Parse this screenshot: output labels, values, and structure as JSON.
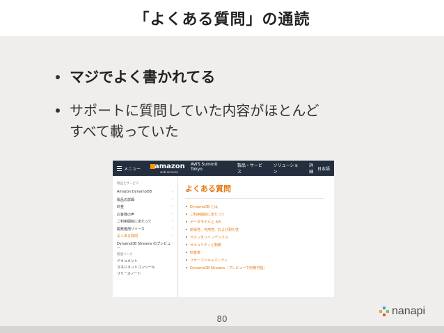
{
  "slide": {
    "title": "「よくある質問」の通読",
    "bullets": [
      "マジでよく書かれてる",
      "サポートに質問していた内容がほとんど\nすべて載っていた"
    ],
    "page_number": "80",
    "brand": "nanapi"
  },
  "screenshot": {
    "topbar": {
      "menu_label": "メニュー",
      "logo_word": "amazon",
      "logo_sub": "web services",
      "nav": [
        "AWS Summit Tokyo",
        "製品・サービス",
        "ソリューション",
        "詳細"
      ],
      "language": "日本語"
    },
    "sidebar": {
      "header": "製品とサービス",
      "items": [
        {
          "label": "Amazon DynamoDB",
          "active": false
        },
        {
          "label": "製品の詳細",
          "active": false
        },
        {
          "label": "料金",
          "active": false
        },
        {
          "label": "お客様の声",
          "active": false
        },
        {
          "label": "ご利用開始にあたって",
          "active": false
        },
        {
          "label": "開発者用リソース",
          "active": false
        },
        {
          "label": "よくある質問",
          "active": true
        },
        {
          "label": "DynamoDB Streams のプレビュー",
          "active": false
        }
      ],
      "links_header": "関連リンク",
      "links": [
        "ドキュメント",
        "マネジメントコンソール",
        "リリースノート"
      ]
    },
    "main": {
      "heading": "よくある質問",
      "items": [
        "DynamoDB とは",
        "ご利用開始にあたって",
        "データモデルと API",
        "拡張性、可用性、および耐久性",
        "セカンダリインデックス",
        "セキュリティと制御",
        "料金表",
        "リザーブドキャパシティ",
        "DynamoDB Streams（プレビューで利用可能）"
      ]
    }
  },
  "colors": {
    "background": "#efeeec",
    "aws_dark": "#232f3e",
    "aws_orange": "#e47911",
    "nanapi_palette": [
      "#f0a23a",
      "#3aa0d8",
      "#7cc24a",
      "#e5533d"
    ]
  }
}
